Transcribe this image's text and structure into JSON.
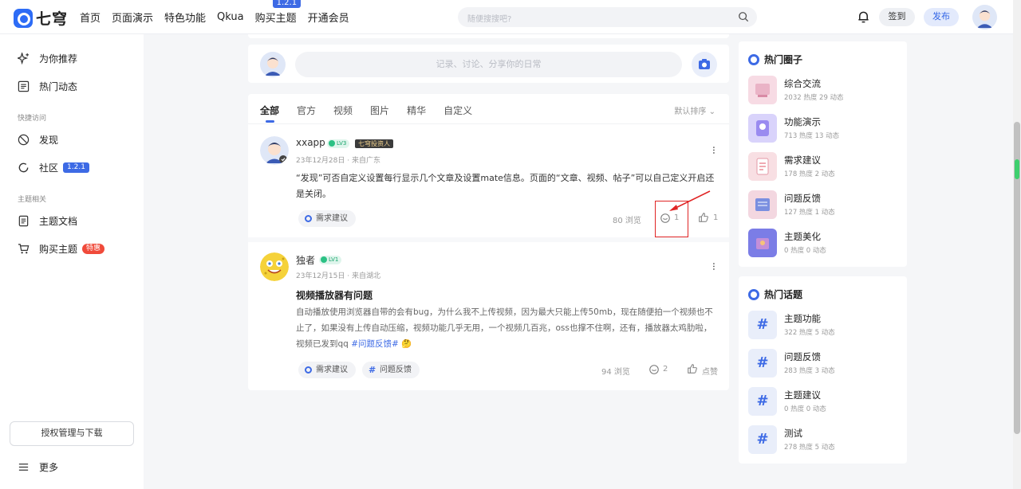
{
  "brand": {
    "name": "七穹",
    "color": "#2d6cf6"
  },
  "nav": {
    "items": [
      "首页",
      "页面演示",
      "特色功能",
      "Qkua",
      "购买主题",
      "开通会员"
    ],
    "badge": "1.2.1"
  },
  "search": {
    "placeholder": "随便搜搜吧?"
  },
  "header": {
    "signin": "签到",
    "publish": "发布"
  },
  "sidebar": {
    "items": [
      {
        "label": "为你推荐",
        "icon": "sparkle-icon"
      },
      {
        "label": "热门动态",
        "icon": "list-icon"
      }
    ],
    "group1": "快捷访问",
    "quick": [
      {
        "label": "发现",
        "icon": "discover-icon"
      },
      {
        "label": "社区",
        "icon": "circle-icon",
        "badge": "1.2.1"
      }
    ],
    "group2": "主题相关",
    "theme": [
      {
        "label": "主题文档",
        "icon": "doc-icon"
      },
      {
        "label": "购买主题",
        "icon": "cart-icon",
        "badge": "特惠"
      }
    ],
    "license": "授权管理与下载",
    "more": "更多"
  },
  "composer": {
    "placeholder": "记录、讨论、分享你的日常"
  },
  "feed": {
    "tabs": [
      "全部",
      "官方",
      "视频",
      "图片",
      "精华",
      "自定义"
    ],
    "sort": "默认排序",
    "posts": [
      {
        "author": "xxapp",
        "level": "LV3",
        "title_badge": "七穹投资人",
        "meta": "23年12月28日 · 来自广东",
        "text": "“发现”可否自定义设置每行显示几个文章及设置mate信息。页面的“文章、视频、帖子”可以自己定义开启还是关闭。",
        "tag": "需求建议",
        "views": "80 浏览",
        "comments": "1",
        "likes": "1"
      },
      {
        "author": "独者",
        "level": "LV1",
        "meta": "23年12月15日 · 来自湖北",
        "title": "视频播放器有问题",
        "body": "自动播放使用浏览器自带的会有bug，为什么我不上传视频，因为最大只能上传50mb，现在随便拍一个视频也不止了，如果没有上传自动压缩，视频功能几乎无用，一个视频几百兆，oss也撑不住啊，还有，播放器太鸡肋啦，视频已发到qq",
        "hashtag": "#问题反馈#",
        "tag1": "需求建议",
        "tag2": "问题反馈",
        "views": "94 浏览",
        "comments": "2",
        "likes": "点赞"
      }
    ]
  },
  "hot_circles": {
    "title": "热门圈子",
    "items": [
      {
        "name": "综合交流",
        "stats": "2032 热度  29 动态"
      },
      {
        "name": "功能演示",
        "stats": "713 热度  13 动态"
      },
      {
        "name": "需求建议",
        "stats": "178 热度  2 动态"
      },
      {
        "name": "问题反馈",
        "stats": "127 热度  1 动态"
      },
      {
        "name": "主题美化",
        "stats": "0 热度  0 动态"
      }
    ]
  },
  "hot_topics": {
    "title": "热门话题",
    "items": [
      {
        "name": "主题功能",
        "stats": "322 热度  5 动态"
      },
      {
        "name": "问题反馈",
        "stats": "283 热度  3 动态"
      },
      {
        "name": "主题建议",
        "stats": "0 热度  0 动态"
      },
      {
        "name": "测试",
        "stats": "278 热度  5 动态"
      }
    ],
    "hash": "#"
  },
  "colors": {
    "accent": "#3d6ae5",
    "annotation": "#e02424"
  }
}
